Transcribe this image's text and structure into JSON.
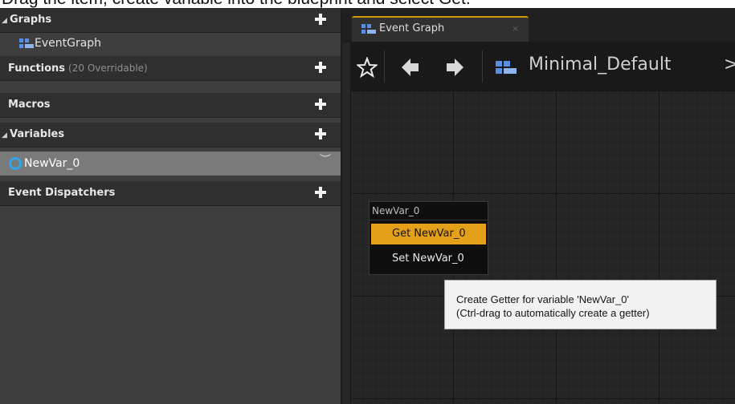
{
  "caption": "Drag the item, create variable into the blueprint and select Get.",
  "sidebar": {
    "graphs": {
      "label": "Graphs",
      "items": [
        {
          "label": "EventGraph"
        }
      ]
    },
    "functions": {
      "label": "Functions",
      "count": "(20 Overridable)"
    },
    "macros": {
      "label": "Macros"
    },
    "variables": {
      "label": "Variables",
      "items": [
        {
          "label": "NewVar_0"
        }
      ]
    },
    "dispatchers": {
      "label": "Event Dispatchers"
    }
  },
  "editor": {
    "tab": {
      "label": "Event Graph",
      "close": "×"
    },
    "toolbar": {
      "breadcrumb": "Minimal_Default",
      "breadcrumb_arrow": ">"
    }
  },
  "context_menu": {
    "title": "NewVar_0",
    "items": [
      {
        "label": "Get NewVar_0"
      },
      {
        "label": "Set NewVar_0"
      }
    ]
  },
  "tooltip": {
    "line1": "Create Getter for variable 'NewVar_0'",
    "line2": "(Ctrl-drag to automatically create a getter)"
  },
  "colors": {
    "accent": "#e5a01a",
    "variable_pin": "#2fa6ea",
    "graph_icon": "#5a8de4"
  }
}
